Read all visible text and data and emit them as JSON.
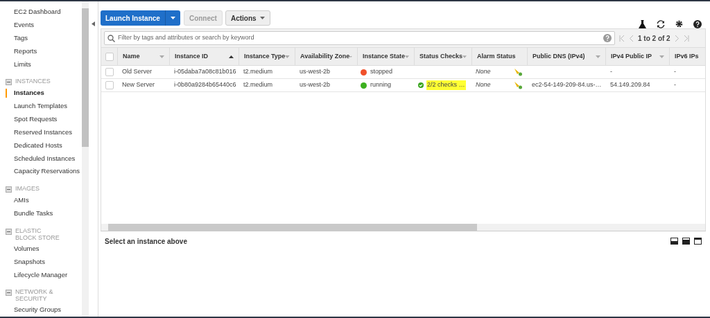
{
  "sidebar": {
    "items": [
      {
        "kind": "link",
        "label": "EC2 Dashboard",
        "selected": false
      },
      {
        "kind": "link",
        "label": "Events",
        "selected": false
      },
      {
        "kind": "link",
        "label": "Tags",
        "selected": false
      },
      {
        "kind": "link",
        "label": "Reports",
        "selected": false
      },
      {
        "kind": "link",
        "label": "Limits",
        "selected": false
      },
      {
        "kind": "section",
        "label": "INSTANCES",
        "expanded": true
      },
      {
        "kind": "link",
        "label": "Instances",
        "selected": true
      },
      {
        "kind": "link",
        "label": "Launch Templates",
        "selected": false
      },
      {
        "kind": "link",
        "label": "Spot Requests",
        "selected": false
      },
      {
        "kind": "link",
        "label": "Reserved Instances",
        "selected": false
      },
      {
        "kind": "link",
        "label": "Dedicated Hosts",
        "selected": false
      },
      {
        "kind": "link",
        "label": "Scheduled Instances",
        "selected": false
      },
      {
        "kind": "link",
        "label": "Capacity Reservations",
        "selected": false
      },
      {
        "kind": "section",
        "label": "IMAGES",
        "expanded": true
      },
      {
        "kind": "link",
        "label": "AMIs",
        "selected": false
      },
      {
        "kind": "link",
        "label": "Bundle Tasks",
        "selected": false
      },
      {
        "kind": "section",
        "label": "ELASTIC BLOCK STORE",
        "expanded": true
      },
      {
        "kind": "link",
        "label": "Volumes",
        "selected": false
      },
      {
        "kind": "link",
        "label": "Snapshots",
        "selected": false
      },
      {
        "kind": "link",
        "label": "Lifecycle Manager",
        "selected": false
      },
      {
        "kind": "section",
        "label": "NETWORK & SECURITY",
        "expanded": true
      },
      {
        "kind": "link",
        "label": "Security Groups",
        "selected": false
      }
    ]
  },
  "toolbar": {
    "launch_button": "Launch Instance",
    "connect_button": {
      "label": "Connect",
      "disabled": true
    },
    "actions_button": "Actions"
  },
  "search": {
    "placeholder": "Filter by tags and attributes or search by keyword"
  },
  "pagination": "1 to 2 of 2",
  "table": {
    "columns": [
      {
        "label": "Name",
        "sorted": false,
        "has_menu": true
      },
      {
        "label": "Instance ID",
        "sorted": true,
        "has_menu": false
      },
      {
        "label": "Instance Type",
        "sorted": false,
        "has_menu": true
      },
      {
        "label": "Availability Zone",
        "sorted": false,
        "has_menu": true
      },
      {
        "label": "Instance State",
        "sorted": false,
        "has_menu": true
      },
      {
        "label": "Status Checks",
        "sorted": false,
        "has_menu": true
      },
      {
        "label": "Alarm Status",
        "sorted": false,
        "has_menu": false
      },
      {
        "label": "Public DNS (IPv4)",
        "sorted": false,
        "has_menu": true
      },
      {
        "label": "IPv4 Public IP",
        "sorted": false,
        "has_menu": true
      },
      {
        "label": "IPv6 IPs",
        "sorted": false,
        "has_menu": false
      }
    ],
    "select_all": {
      "checked": false
    },
    "rows": [
      {
        "checked": false,
        "name": "Old Server",
        "instance_id": "i-05daba7a08c81b016",
        "type": "t2.medium",
        "zone": "us-west-2b",
        "state": "stopped",
        "color": "#f0502a",
        "status_checks": null,
        "alarm": "None",
        "public_dns": "",
        "ipv4": "-",
        "ipv6": "-"
      },
      {
        "checked": false,
        "name": "New Server",
        "instance_id": "i-0b80a9284b65440c6",
        "type": "t2.medium",
        "zone": "us-west-2b",
        "state": "running",
        "color": "#3cb01f",
        "status_checks": "2/2 checks …",
        "alarm": "None",
        "public_dns": "ec2-54-149-209-84.us-…",
        "ipv4": "54.149.209.84",
        "ipv6": "-"
      }
    ]
  },
  "details": {
    "message": "Select an instance above"
  }
}
